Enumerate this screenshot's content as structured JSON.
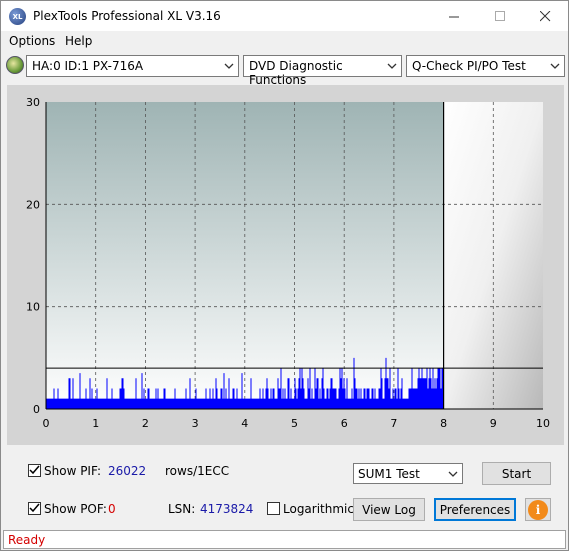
{
  "window": {
    "title": "PlexTools Professional XL V3.16",
    "app_icon_text": "XL"
  },
  "menu": {
    "options": "Options",
    "help": "Help"
  },
  "toolbar": {
    "drive": "HA:0 ID:1  PX-716A",
    "function": "DVD Diagnostic Functions",
    "test": "Q-Check PI/PO Test"
  },
  "chart_data": {
    "type": "bar",
    "xlim": [
      0,
      10
    ],
    "ylim": [
      0,
      30
    ],
    "x_ticks": [
      "0",
      "1",
      "2",
      "3",
      "4",
      "5",
      "6",
      "7",
      "8",
      "9",
      "10"
    ],
    "y_ticks": [
      "0",
      "10",
      "20",
      "30"
    ],
    "threshold": 4,
    "data_end_x": 8,
    "grid": true,
    "series": [
      {
        "values_summary": "PIF values mostly 1 across 0–8, frequent spikes 2–3, up to ~4–5 near 4.6–8"
      }
    ],
    "colors": {
      "bars": "#0000ff",
      "bg_top": "#9fb4b4",
      "bg_bottom": "#ffffff",
      "panel": "#d4d4d4"
    }
  },
  "controls": {
    "show_pif_label": "Show PIF:",
    "pif_value": "26022",
    "pif_unit": "rows/1ECC",
    "show_pof_label": "Show POF:",
    "pof_value": "0",
    "lsn_label": "LSN:",
    "lsn_value": "4173824",
    "logarithmic_label": "Logarithmic",
    "sum_select": "SUM1 Test",
    "start_button": "Start",
    "viewlog_button": "View Log",
    "preferences_button": "Preferences",
    "pif_checked": true,
    "pof_checked": true,
    "log_checked": false
  },
  "status": {
    "text": "Ready"
  }
}
